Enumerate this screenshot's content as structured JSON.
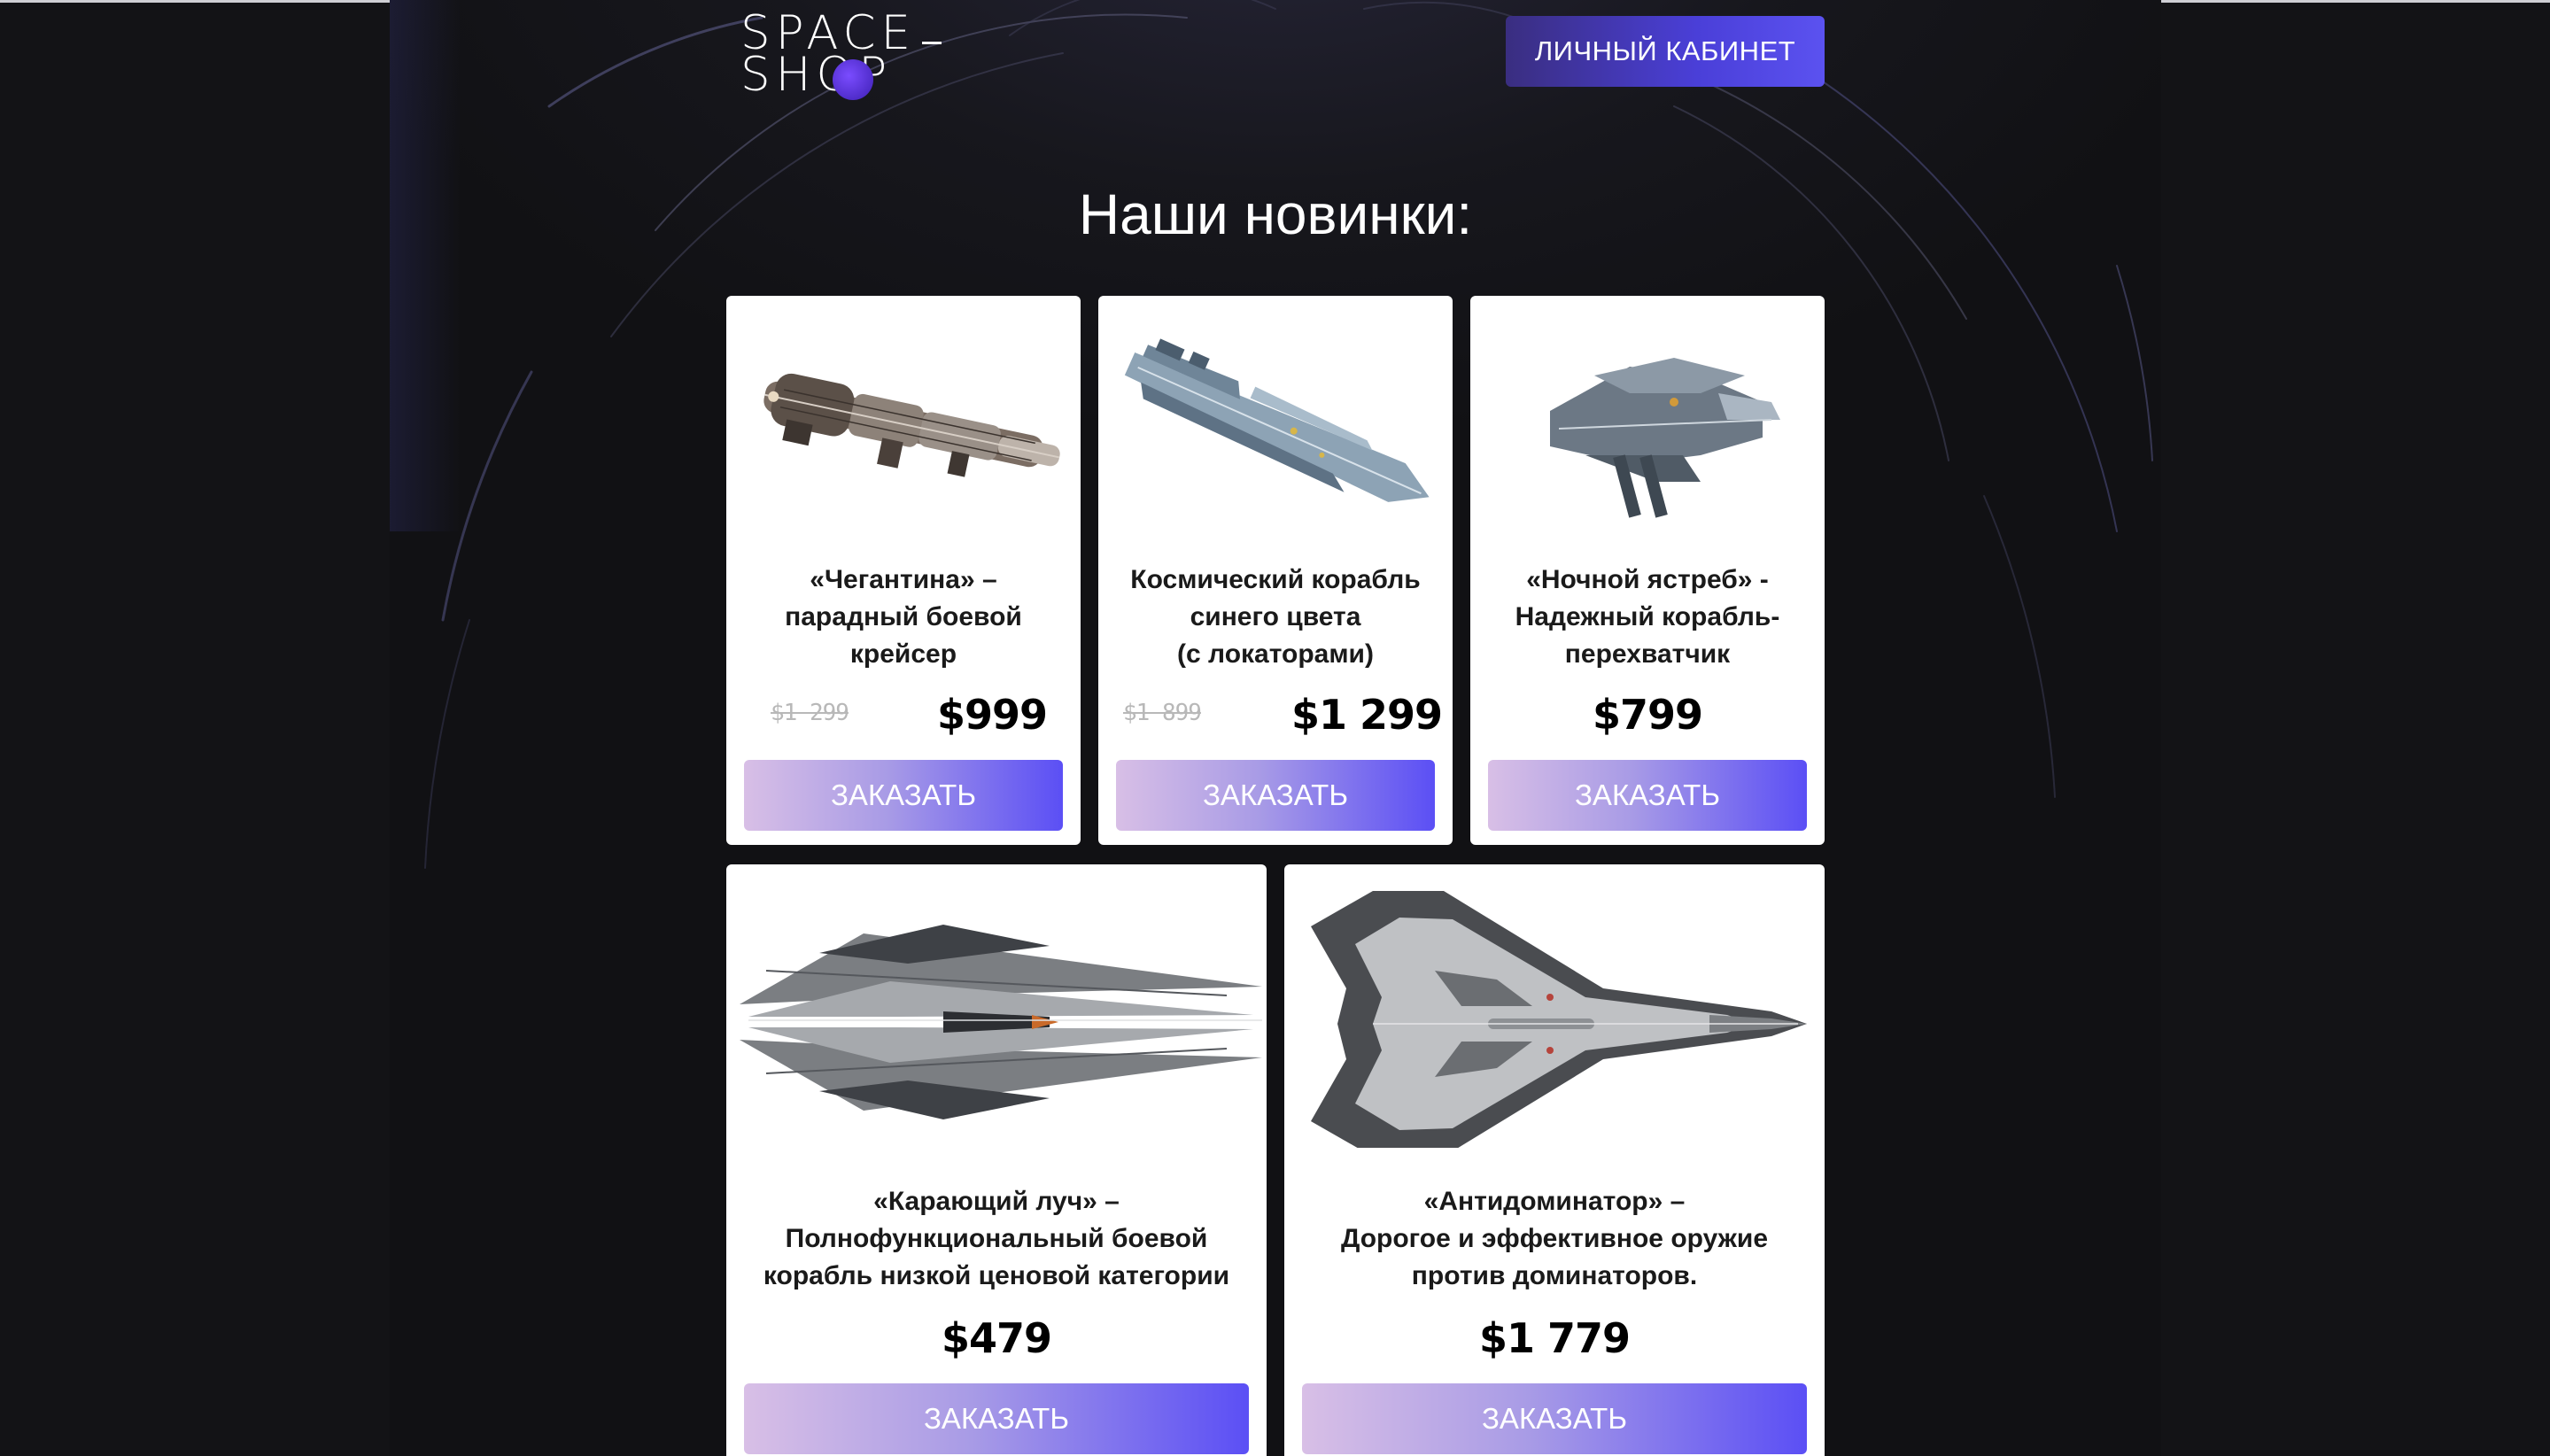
{
  "header": {
    "logo_line1": "SPACE",
    "logo_line2": "SHOP",
    "cabinet_button": "ЛИЧНЫЙ КАБИНЕТ"
  },
  "section": {
    "title": "Наши новинки:"
  },
  "order_label": "ЗАКАЗАТЬ",
  "products": [
    {
      "title_lines": [
        "«Чегантина» –",
        "парадный боевой",
        "крейсер"
      ],
      "old_price": "$1 299",
      "price": "$999",
      "button": "ЗАКАЗАТЬ",
      "image": "cruiser-ship-icon"
    },
    {
      "title_lines": [
        "Космический корабль",
        "синего цвета",
        "(с локаторами)"
      ],
      "old_price": "$1 899",
      "price": "$1 299",
      "button": "ЗАКАЗАТЬ",
      "image": "blue-ship-icon"
    },
    {
      "title_lines": [
        "«Ночной ястреб» -",
        "Надежный корабль-",
        "перехватчик"
      ],
      "old_price": "",
      "price": "$799",
      "button": "ЗАКАЗАТЬ",
      "image": "interceptor-ship-icon"
    },
    {
      "title_lines": [
        "«Карающий луч» –",
        "Полнофункциональный боевой",
        "корабль низкой ценовой категории"
      ],
      "old_price": "",
      "price": "$479",
      "button": "ЗАКАЗАТЬ",
      "image": "blade-ship-icon"
    },
    {
      "title_lines": [
        "«Антидоминатор» –",
        "Дорогое и эффективное оружие",
        "против доминаторов."
      ],
      "old_price": "",
      "price": "$1 779",
      "button": "ЗАКАЗАТЬ",
      "image": "fighter-jet-icon"
    }
  ],
  "colors": {
    "background": "#131316",
    "button_gradient_start": "#d8bfe6",
    "button_gradient_end": "#5b4ff5",
    "cabinet_button": "#4a3fd8",
    "logo_dot": "#5a2fe0"
  }
}
